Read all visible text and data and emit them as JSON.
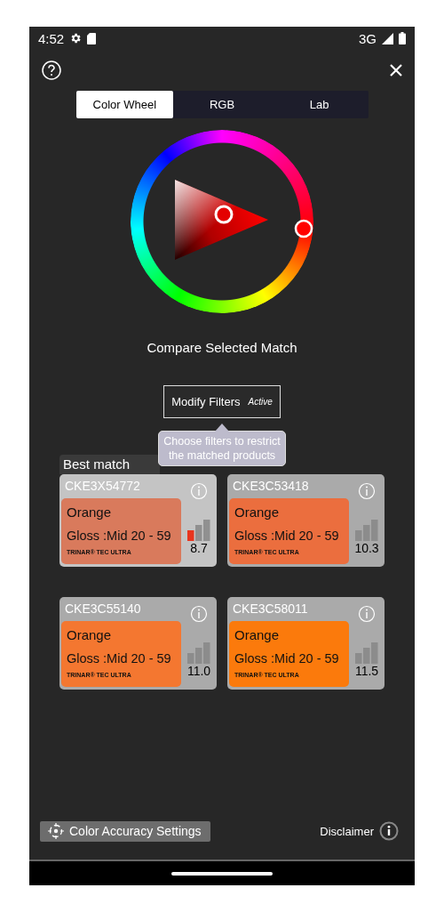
{
  "status_bar": {
    "time": "4:52",
    "network": "3G"
  },
  "tabs": [
    {
      "label": "Color Wheel",
      "selected": true
    },
    {
      "label": "RGB",
      "selected": false
    },
    {
      "label": "Lab",
      "selected": false
    }
  ],
  "compare_label": "Compare Selected Match",
  "filters": {
    "label": "Modify Filters",
    "badge": "Active",
    "tooltip": "Choose filters to restrict the matched products"
  },
  "best_match_label": "Best match",
  "matches": [
    {
      "code": "CKE3X54772",
      "name": "Orange",
      "gloss": "Gloss :Mid 20 - 59",
      "brand": "TRINAR® TEC ULTRA",
      "score": "8.7",
      "color": "#d97a5c",
      "selected": true,
      "flagged": true
    },
    {
      "code": "CKE3C53418",
      "name": "Orange",
      "gloss": "Gloss :Mid 20 - 59",
      "brand": "TRINAR® TEC ULTRA",
      "score": "10.3",
      "color": "#eb6e3e",
      "selected": false,
      "flagged": false
    },
    {
      "code": "CKE3C55140",
      "name": "Orange",
      "gloss": "Gloss :Mid 20 - 59",
      "brand": "TRINAR® TEC ULTRA",
      "score": "11.0",
      "color": "#f47730",
      "selected": false,
      "flagged": false
    },
    {
      "code": "CKE3C58011",
      "name": "Orange",
      "gloss": "Gloss :Mid 20 - 59",
      "brand": "TRINAR® TEC ULTRA",
      "score": "11.5",
      "color": "#fb7a0c",
      "selected": false,
      "flagged": false
    }
  ],
  "footer": {
    "settings_button": "Color Accuracy Settings",
    "disclaimer": "Disclaimer"
  }
}
